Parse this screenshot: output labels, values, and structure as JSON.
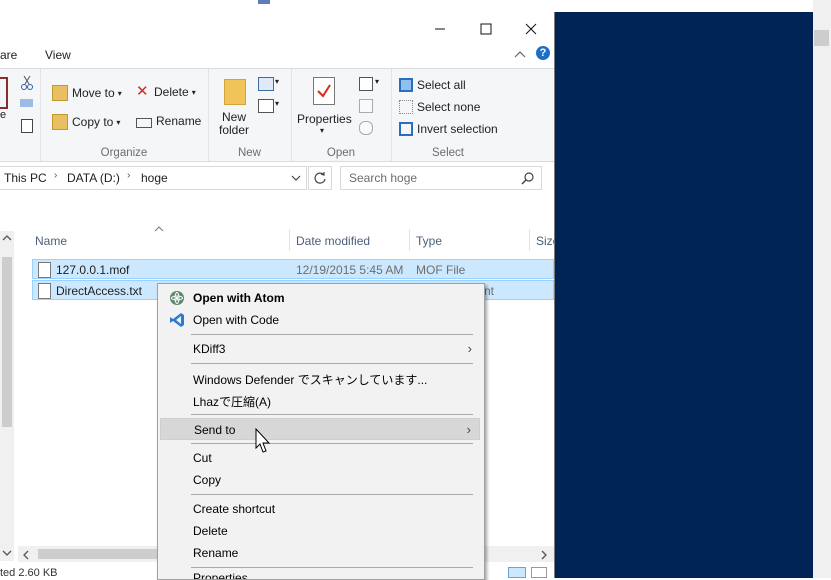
{
  "window": {
    "minimize_glyph": "—",
    "maximize_glyph": "☐",
    "close_glyph": "✕",
    "tabs": [
      "are",
      "View"
    ],
    "collapse_glyph": "^",
    "help_glyph": "?"
  },
  "ribbon": {
    "organize": {
      "move_to": "Move to",
      "copy_to": "Copy to",
      "delete": "Delete",
      "rename": "Rename",
      "label": "Organize"
    },
    "new": {
      "new_folder_line1": "New",
      "new_folder_line2": "folder",
      "label": "New"
    },
    "open": {
      "properties": "Properties",
      "label": "Open"
    },
    "select": {
      "select_all": "Select all",
      "select_none": "Select none",
      "invert_selection": "Invert selection",
      "label": "Select"
    }
  },
  "address": {
    "crumbs": [
      "This PC",
      "DATA (D:)",
      "hoge"
    ],
    "search_placeholder": "Search hoge"
  },
  "columns": {
    "name": "Name",
    "date_modified": "Date modified",
    "type": "Type",
    "size": "Size"
  },
  "files": [
    {
      "name": "127.0.0.1.mof",
      "date": "12/19/2015 5:45 AM",
      "type": "MOF File"
    },
    {
      "name": "DirectAccess.txt",
      "type_partial": "nt"
    }
  ],
  "status": {
    "text": "ted  2.60 KB"
  },
  "context_menu": {
    "open_with_atom": "Open with Atom",
    "open_with_code": "Open with Code",
    "kdiff3": "KDiff3",
    "defender": "Windows Defender でスキャンしています...",
    "lhaz": "Lhazで圧縮(A)",
    "send_to": "Send to",
    "cut": "Cut",
    "copy": "Copy",
    "create_shortcut": "Create shortcut",
    "delete": "Delete",
    "rename": "Rename",
    "properties_partial": "Properties"
  },
  "colors": {
    "desktop_blue": "#012456",
    "selection": "#cce8ff",
    "menu_bg": "#f2f2f2"
  }
}
